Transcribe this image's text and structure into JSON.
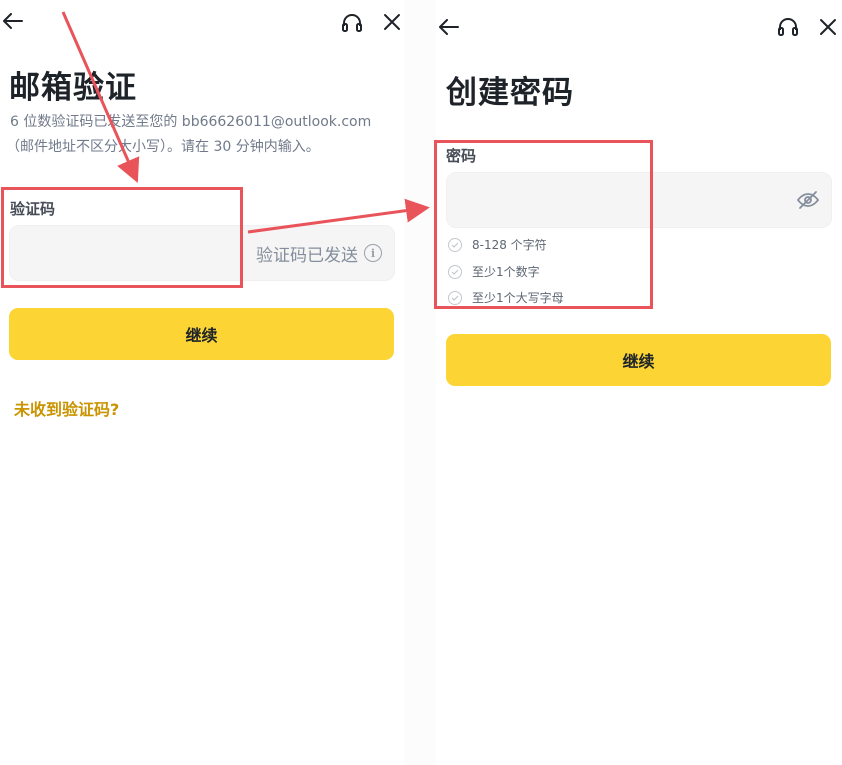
{
  "left": {
    "title": "邮箱验证",
    "description_line1": "6 位数验证码已发送至您的 bb66626011@outlook.com",
    "description_line2": "（邮件地址不区分大小写）。请在 30 分钟内输入。",
    "code_field": {
      "label": "验证码",
      "value": "",
      "status": "验证码已发送",
      "info_glyph": "i"
    },
    "continue_label": "继续",
    "resend_link": "未收到验证码?"
  },
  "right": {
    "title": "创建密码",
    "password_field": {
      "label": "密码",
      "value": ""
    },
    "rules": [
      {
        "text": "8-128 个字符"
      },
      {
        "text": "至少1个数字"
      },
      {
        "text": "至少1个大写字母"
      }
    ],
    "continue_label": "继续"
  },
  "icons": {
    "back": "arrow-left-icon",
    "support": "headset-icon",
    "close": "close-icon",
    "info": "info-icon",
    "eye_off": "eye-off-icon",
    "check": "check-circle-icon"
  },
  "colors": {
    "accent": "#fcd535",
    "link": "#c99400",
    "annotation": "#e9545a",
    "input_bg": "#f5f5f5"
  }
}
